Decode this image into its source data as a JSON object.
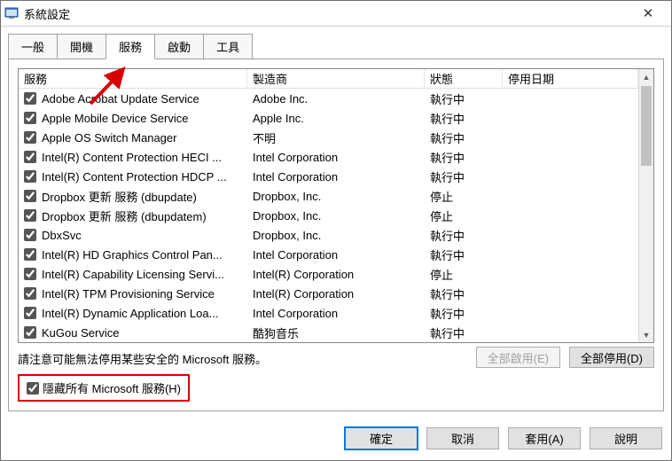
{
  "window": {
    "title": "系統設定",
    "close_glyph": "✕"
  },
  "tabs": {
    "general": "一般",
    "boot": "開機",
    "services": "服務",
    "startup": "啟動",
    "tools": "工具"
  },
  "headers": {
    "service": "服務",
    "manufacturer": "製造商",
    "status": "狀態",
    "date": "停用日期"
  },
  "rows": [
    {
      "name": "Adobe Acrobat Update Service",
      "mfr": "Adobe Inc.",
      "status": "執行中",
      "date": ""
    },
    {
      "name": "Apple Mobile Device Service",
      "mfr": "Apple Inc.",
      "status": "執行中",
      "date": ""
    },
    {
      "name": "Apple OS Switch Manager",
      "mfr": "不明",
      "status": "執行中",
      "date": ""
    },
    {
      "name": "Intel(R) Content Protection HECI ...",
      "mfr": "Intel Corporation",
      "status": "執行中",
      "date": ""
    },
    {
      "name": "Intel(R) Content Protection HDCP ...",
      "mfr": "Intel Corporation",
      "status": "執行中",
      "date": ""
    },
    {
      "name": "Dropbox 更新 服務 (dbupdate)",
      "mfr": "Dropbox, Inc.",
      "status": "停止",
      "date": ""
    },
    {
      "name": "Dropbox 更新 服務 (dbupdatem)",
      "mfr": "Dropbox, Inc.",
      "status": "停止",
      "date": ""
    },
    {
      "name": "DbxSvc",
      "mfr": "Dropbox, Inc.",
      "status": "執行中",
      "date": ""
    },
    {
      "name": "Intel(R) HD Graphics Control Pan...",
      "mfr": "Intel Corporation",
      "status": "執行中",
      "date": ""
    },
    {
      "name": "Intel(R) Capability Licensing Servi...",
      "mfr": "Intel(R) Corporation",
      "status": "停止",
      "date": ""
    },
    {
      "name": "Intel(R) TPM Provisioning Service",
      "mfr": "Intel(R) Corporation",
      "status": "執行中",
      "date": ""
    },
    {
      "name": "Intel(R) Dynamic Application Loa...",
      "mfr": "Intel Corporation",
      "status": "執行中",
      "date": ""
    },
    {
      "name": "KuGou Service",
      "mfr": "酷狗音乐",
      "status": "執行中",
      "date": ""
    }
  ],
  "note": "請注意可能無法停用某些安全的 Microsoft 服務。",
  "buttons": {
    "enable_all": "全部啟用(E)",
    "disable_all": "全部停用(D)",
    "ok": "確定",
    "cancel": "取消",
    "apply": "套用(A)",
    "help": "說明"
  },
  "hide_ms": "隱藏所有 Microsoft 服務(H)",
  "scroll": {
    "up": "▲",
    "down": "▼"
  }
}
